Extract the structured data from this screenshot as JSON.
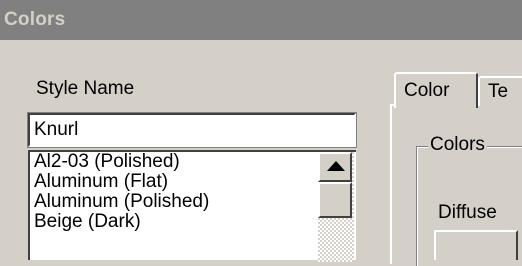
{
  "window": {
    "title": "Colors"
  },
  "style_name": {
    "label": "Style Name",
    "value": "Knurl",
    "items": [
      "Al2-03 (Polished)",
      "Aluminum (Flat)",
      "Aluminum (Polished)",
      "Beige (Dark)"
    ]
  },
  "tabs": [
    {
      "label": "Color",
      "active": true
    },
    {
      "label": "Te",
      "active": false
    }
  ],
  "colors_group": {
    "legend": "Colors",
    "diffuse_label": "Diffuse"
  }
}
